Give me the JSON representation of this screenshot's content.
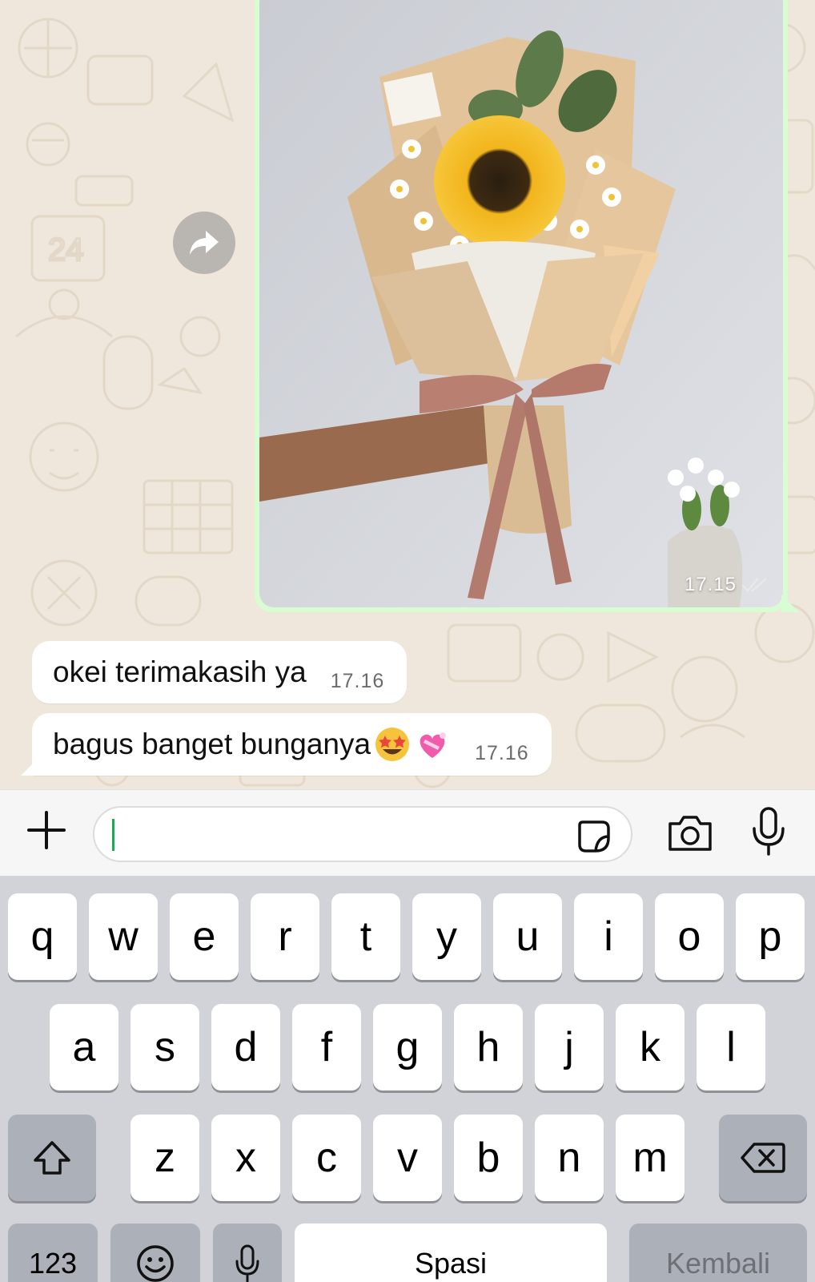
{
  "chat": {
    "image_message": {
      "time": "17.15",
      "status_icon": "double-check-icon"
    },
    "messages": [
      {
        "text": "okei terimakasih ya",
        "time": "17.16"
      },
      {
        "text": "bagus banget bunganya",
        "emojis": [
          "star-struck-emoji",
          "heart-with-ribbon-emoji"
        ],
        "time": "17.16"
      }
    ]
  },
  "input_bar": {
    "plus_icon": "plus-icon",
    "sticker_icon": "sticker-icon",
    "camera_icon": "camera-icon",
    "mic_icon": "mic-icon",
    "value": ""
  },
  "keyboard": {
    "row1": [
      "q",
      "w",
      "e",
      "r",
      "t",
      "y",
      "u",
      "i",
      "o",
      "p"
    ],
    "row2": [
      "a",
      "s",
      "d",
      "f",
      "g",
      "h",
      "j",
      "k",
      "l"
    ],
    "row3": [
      "z",
      "x",
      "c",
      "v",
      "b",
      "n",
      "m"
    ],
    "numbers_label": "123",
    "space_label": "Spasi",
    "return_label": "Kembali",
    "shift_icon": "shift-icon",
    "backspace_icon": "backspace-icon",
    "emoji_icon": "emoji-icon",
    "dictation_icon": "mic-icon"
  }
}
